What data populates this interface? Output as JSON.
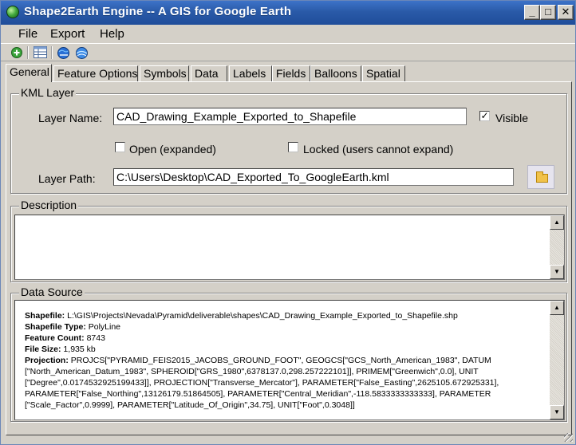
{
  "window": {
    "title": "Shape2Earth Engine -- A GIS for Google Earth",
    "minimize_glyph": "_",
    "maximize_glyph": "□",
    "close_glyph": "✕"
  },
  "menu": {
    "file": "File",
    "export": "Export",
    "help": "Help"
  },
  "tabs": [
    "General",
    "Feature Options",
    "Symbols",
    "Data",
    "Labels",
    "Fields",
    "Balloons",
    "Spatial"
  ],
  "kml_layer": {
    "group_title": "KML Layer",
    "layer_name_label": "Layer Name:",
    "layer_name_value": "CAD_Drawing_Example_Exported_to_Shapefile",
    "visible_label": "Visible",
    "visible_checked": "✓",
    "open_label": "Open (expanded)",
    "locked_label": "Locked (users cannot expand)",
    "layer_path_label": "Layer Path:",
    "layer_path_value": "C:\\Users\\Desktop\\CAD_Exported_To_GoogleEarth.kml"
  },
  "description": {
    "group_title": "Description"
  },
  "data_source": {
    "group_title": "Data Source",
    "shapefile_label": "Shapefile:",
    "shapefile_value": " L:\\GIS\\Projects\\Nevada\\Pyramid\\deliverable\\shapes\\CAD_Drawing_Example_Exported_to_Shapefile.shp",
    "type_label": "Shapefile Type:",
    "type_value": " PolyLine",
    "count_label": "Feature Count:",
    "count_value": " 8743",
    "size_label": "File Size:",
    "size_value": " 1,935 kb",
    "projection_label": "Projection:",
    "projection_value": " PROJCS[\"PYRAMID_FEIS2015_JACOBS_GROUND_FOOT\", GEOGCS[\"GCS_North_American_1983\", DATUM [\"North_American_Datum_1983\", SPHEROID[\"GRS_1980\",6378137.0,298.257222101]], PRIMEM[\"Greenwich\",0.0], UNIT [\"Degree\",0.0174532925199433]], PROJECTION[\"Transverse_Mercator\"], PARAMETER[\"False_Easting\",2625105.672925331], PARAMETER[\"False_Northing\",13126179.51864505], PARAMETER[\"Central_Meridian\",-118.5833333333333], PARAMETER [\"Scale_Factor\",0.9999], PARAMETER[\"Latitude_Of_Origin\",34.75], UNIT[\"Foot\",0.3048]]"
  }
}
